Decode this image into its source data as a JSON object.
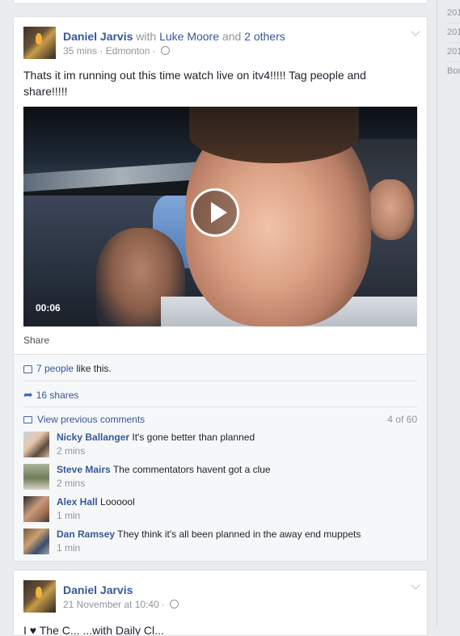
{
  "right_rail": {
    "years": [
      "201",
      "201",
      "201",
      "Bor"
    ]
  },
  "post1": {
    "author": "Daniel Jarvis",
    "with_word": "with",
    "tagged": "Luke Moore",
    "and_word": "and",
    "others": "2 others",
    "time": "35 mins",
    "location": "Edmonton",
    "text": "Thats it im running out this time watch live on itv4!!!!! Tag people and share!!!!!",
    "video": {
      "duration": "00:06",
      "play_icon": "play-icon"
    },
    "share_label": "Share",
    "likes": {
      "count": "7 people",
      "suffix": "like this."
    },
    "shares": "16 shares",
    "view_previous": "View previous comments",
    "pager": "4 of 60",
    "comments": [
      {
        "name": "Nicky Ballanger",
        "text": "It's gone better than planned",
        "time": "2 mins"
      },
      {
        "name": "Steve Mairs",
        "text": "The commentators havent got a clue",
        "time": "2 mins"
      },
      {
        "name": "Alex Hall",
        "text": "Loooool",
        "time": "1 min"
      },
      {
        "name": "Dan Ramsey",
        "text": "They think it's all been planned in the away end muppets",
        "time": "1 min"
      }
    ]
  },
  "post2": {
    "author": "Daniel Jarvis",
    "time": "21 November at 10:40",
    "partial_text": "I ♥ The C...           ...with Daily Cl..."
  },
  "colors": {
    "link": "#365899",
    "muted": "#90949c",
    "background": "#e9ebee",
    "accent": "#4267b2"
  }
}
